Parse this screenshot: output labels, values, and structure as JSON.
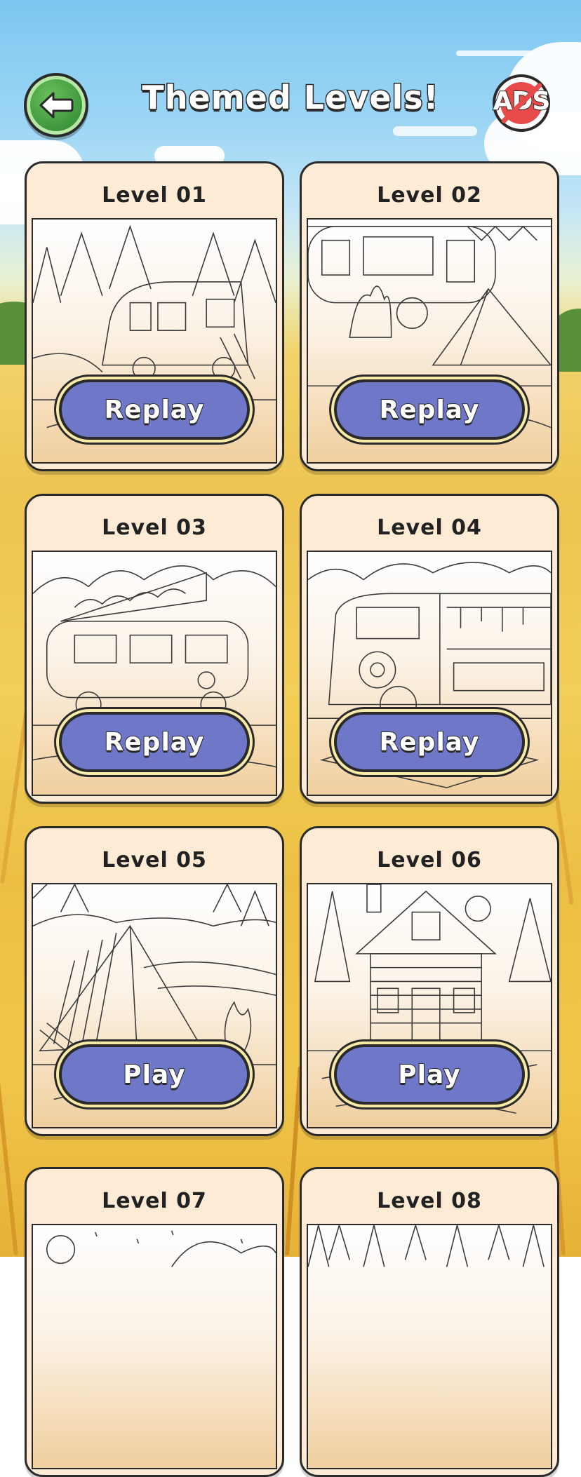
{
  "header": {
    "title": "Themed Levels!",
    "back_icon": "arrow-left-icon",
    "no_ads_label": "ADS",
    "no_ads_icon": "no-ads-icon"
  },
  "colors": {
    "card_bg": "#fdebd6",
    "button_bg": "#6f78c8",
    "button_ring": "#f7e9a6",
    "back_green": "#3f9a3e",
    "no_ads_red": "#e84a4a",
    "outline": "#2a2a2a"
  },
  "levels": [
    {
      "label": "Level 01",
      "action": "Replay",
      "scene": "camper-van-forest"
    },
    {
      "label": "Level 02",
      "action": "Replay",
      "scene": "caravan-tent"
    },
    {
      "label": "Level 03",
      "action": "Replay",
      "scene": "popup-camper-bus"
    },
    {
      "label": "Level 04",
      "action": "Replay",
      "scene": "flower-bus-awning"
    },
    {
      "label": "Level 05",
      "action": "Play",
      "scene": "tent-campfire-lake"
    },
    {
      "label": "Level 06",
      "action": "Play",
      "scene": "log-cabin"
    },
    {
      "label": "Level 07",
      "action": "",
      "scene": "night-sky"
    },
    {
      "label": "Level 08",
      "action": "",
      "scene": "forest"
    }
  ]
}
